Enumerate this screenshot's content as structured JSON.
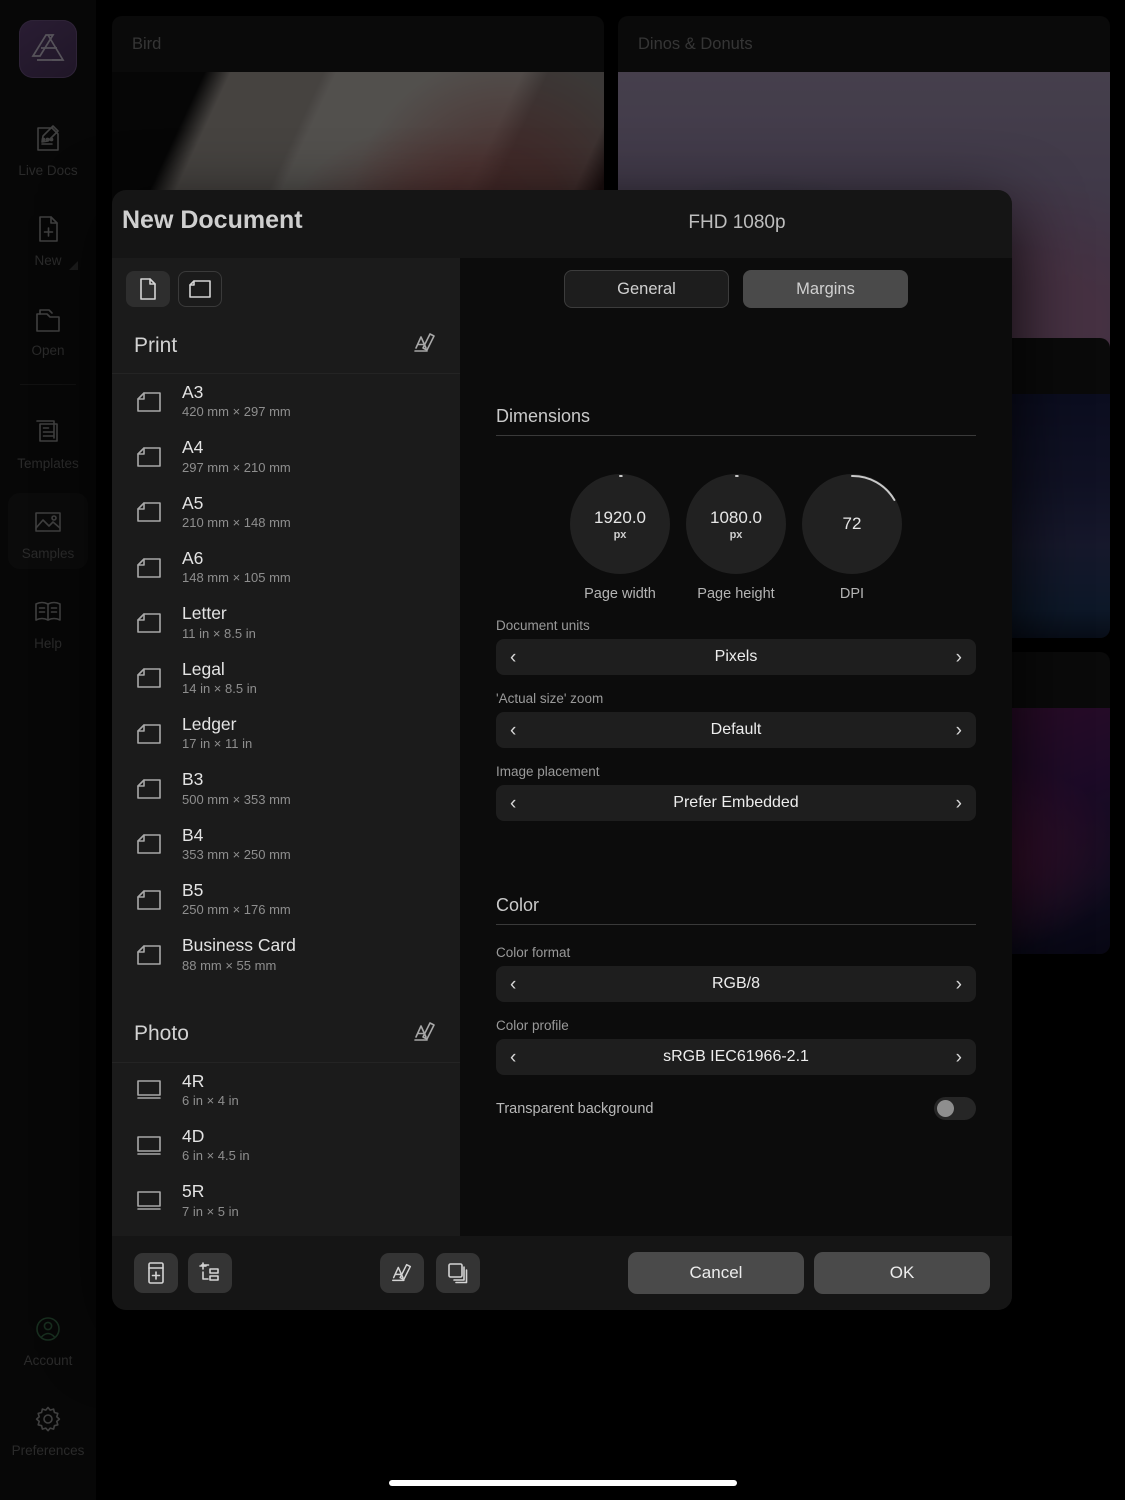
{
  "sidebar": {
    "logo": "affinity-logo-icon",
    "items": [
      {
        "label": "Live Docs",
        "icon": "live-docs-icon",
        "active": false
      },
      {
        "label": "New",
        "icon": "new-document-icon",
        "active": false
      },
      {
        "label": "Open",
        "icon": "open-folder-icon",
        "active": false
      },
      {
        "label": "Templates",
        "icon": "templates-icon",
        "active": false
      },
      {
        "label": "Samples",
        "icon": "samples-image-icon",
        "active": true
      },
      {
        "label": "Help",
        "icon": "help-book-icon",
        "active": false
      }
    ],
    "bottom_items": [
      {
        "label": "Account",
        "icon": "account-person-icon"
      },
      {
        "label": "Preferences",
        "icon": "gear-icon"
      }
    ]
  },
  "background_cards": [
    {
      "title": "Bird",
      "thumb": "thumb-bird"
    },
    {
      "title": "Dinos & Donuts",
      "thumb": "thumb-dino"
    },
    {
      "title": "",
      "thumb": "thumb-stars"
    },
    {
      "title": "",
      "thumb": "thumb-jelly"
    }
  ],
  "dialog": {
    "title": "New Document",
    "preset_name": "FHD 1080p",
    "orientation_buttons": [
      {
        "name": "portrait-orientation-button",
        "icon": "page-portrait-icon",
        "selected": true
      },
      {
        "name": "landscape-orientation-button",
        "icon": "page-landscape-icon",
        "selected": false
      }
    ],
    "tabs": [
      {
        "label": "General",
        "selected": true
      },
      {
        "label": "Margins",
        "selected": false
      }
    ],
    "groups": [
      {
        "title": "Print",
        "edit_icon": "rename-pencil-icon",
        "presets": [
          {
            "name": "A3",
            "dimensions": "420 mm × 297 mm",
            "icon": "page-landscape-icon"
          },
          {
            "name": "A4",
            "dimensions": "297 mm × 210 mm",
            "icon": "page-landscape-icon"
          },
          {
            "name": "A5",
            "dimensions": "210 mm × 148 mm",
            "icon": "page-landscape-icon"
          },
          {
            "name": "A6",
            "dimensions": "148 mm × 105 mm",
            "icon": "page-landscape-icon"
          },
          {
            "name": "Letter",
            "dimensions": "11 in × 8.5 in",
            "icon": "page-landscape-icon"
          },
          {
            "name": "Legal",
            "dimensions": "14 in × 8.5 in",
            "icon": "page-landscape-icon"
          },
          {
            "name": "Ledger",
            "dimensions": "17 in × 11 in",
            "icon": "page-landscape-icon"
          },
          {
            "name": "B3",
            "dimensions": "500 mm × 353 mm",
            "icon": "page-landscape-icon"
          },
          {
            "name": "B4",
            "dimensions": "353 mm × 250 mm",
            "icon": "page-landscape-icon"
          },
          {
            "name": "B5",
            "dimensions": "250 mm × 176 mm",
            "icon": "page-landscape-icon"
          },
          {
            "name": "Business Card",
            "dimensions": "88 mm × 55 mm",
            "icon": "page-landscape-icon"
          }
        ]
      },
      {
        "title": "Photo",
        "edit_icon": "rename-pencil-icon",
        "presets": [
          {
            "name": "4R",
            "dimensions": "6 in × 4 in",
            "icon": "photo-icon"
          },
          {
            "name": "4D",
            "dimensions": "6 in × 4.5 in",
            "icon": "photo-icon"
          },
          {
            "name": "5R",
            "dimensions": "7 in × 5 in",
            "icon": "photo-icon"
          }
        ]
      }
    ],
    "sections": {
      "dimensions": {
        "title": "Dimensions",
        "dials": [
          {
            "value": "1920.0",
            "unit": "px",
            "label": "Page width",
            "arc_deg": 2
          },
          {
            "value": "1080.0",
            "unit": "px",
            "label": "Page height",
            "arc_deg": 2
          },
          {
            "value": "72",
            "unit": "",
            "label": "DPI",
            "arc_deg": 62
          }
        ],
        "fields": [
          {
            "label": "Document units",
            "value": "Pixels"
          },
          {
            "label": "'Actual size' zoom",
            "value": "Default"
          },
          {
            "label": "Image placement",
            "value": "Prefer Embedded"
          }
        ]
      },
      "color": {
        "title": "Color",
        "fields": [
          {
            "label": "Color format",
            "value": "RGB/8"
          },
          {
            "label": "Color profile",
            "value": "sRGB IEC61966-2.1"
          }
        ],
        "toggle": {
          "label": "Transparent background",
          "on": false
        }
      }
    },
    "footer": {
      "left_buttons": [
        {
          "name": "add-preset-button",
          "icon": "add-document-preset-icon"
        },
        {
          "name": "add-category-button",
          "icon": "add-category-icon"
        }
      ],
      "mid_buttons": [
        {
          "name": "rename-preset-button",
          "icon": "rename-pencil-icon"
        },
        {
          "name": "duplicate-preset-button",
          "icon": "duplicate-stack-icon"
        }
      ],
      "cancel_label": "Cancel",
      "ok_label": "OK"
    }
  },
  "colors": {
    "dialog_bg": "#151515",
    "left_pane_bg": "#1b1b1b",
    "right_pane_bg": "#0c0c0c",
    "accent_purple": "#6d4c86",
    "account_green": "#3f7a52"
  }
}
